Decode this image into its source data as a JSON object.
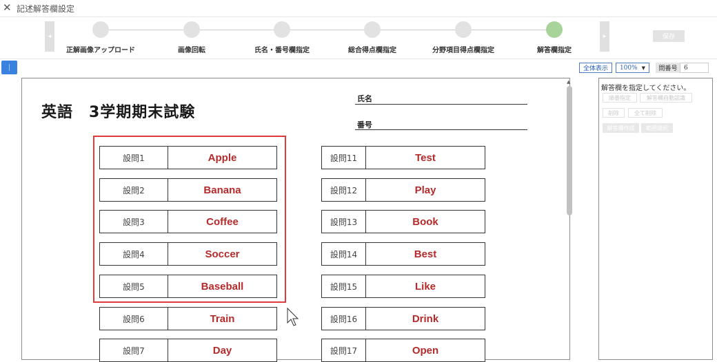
{
  "window": {
    "title": "記述解答欄設定"
  },
  "wizard": {
    "prev_icon": "◂",
    "next_icon": "▸",
    "steps": [
      {
        "label": "正解画像アップロード",
        "active": false
      },
      {
        "label": "画像回転",
        "active": false
      },
      {
        "label": "氏名・番号欄指定",
        "active": false
      },
      {
        "label": "総合得点欄指定",
        "active": false
      },
      {
        "label": "分野項目得点欄指定",
        "active": false
      },
      {
        "label": "解答欄指定",
        "active": true
      }
    ],
    "save_label": "保存",
    "active_color": "#a8d49a"
  },
  "toolbar": {
    "show_all_label": "全体表示",
    "zoom_value": "100%",
    "question_no_label": "問番号",
    "question_no_value": "6",
    "accent": "#3b82e0"
  },
  "document": {
    "title": "英語　3学期期末試験",
    "name_label": "氏名",
    "number_label": "番号",
    "left_rows": [
      {
        "q": "設問1",
        "a": "Apple"
      },
      {
        "q": "設問2",
        "a": "Banana"
      },
      {
        "q": "設問3",
        "a": "Coffee"
      },
      {
        "q": "設問4",
        "a": "Soccer"
      },
      {
        "q": "設問5",
        "a": "Baseball"
      },
      {
        "q": "設問6",
        "a": "Train"
      },
      {
        "q": "設問7",
        "a": "Day"
      }
    ],
    "right_rows": [
      {
        "q": "設問11",
        "a": "Test"
      },
      {
        "q": "設問12",
        "a": "Play"
      },
      {
        "q": "設問13",
        "a": "Book"
      },
      {
        "q": "設問14",
        "a": "Best"
      },
      {
        "q": "設問15",
        "a": "Like"
      },
      {
        "q": "設問16",
        "a": "Drink"
      },
      {
        "q": "設問17",
        "a": "Open"
      }
    ],
    "highlight_color": "#e03a3a",
    "answer_color": "#b52a2a"
  },
  "right_panel": {
    "instruction": "解答欄を指定してください。",
    "buttons": {
      "specify": "順番指定",
      "auto_detect": "解答欄自動認識",
      "delete": "削除",
      "delete_all": "全て削除",
      "create": "解答欄作成",
      "select_range": "範囲選択"
    }
  }
}
